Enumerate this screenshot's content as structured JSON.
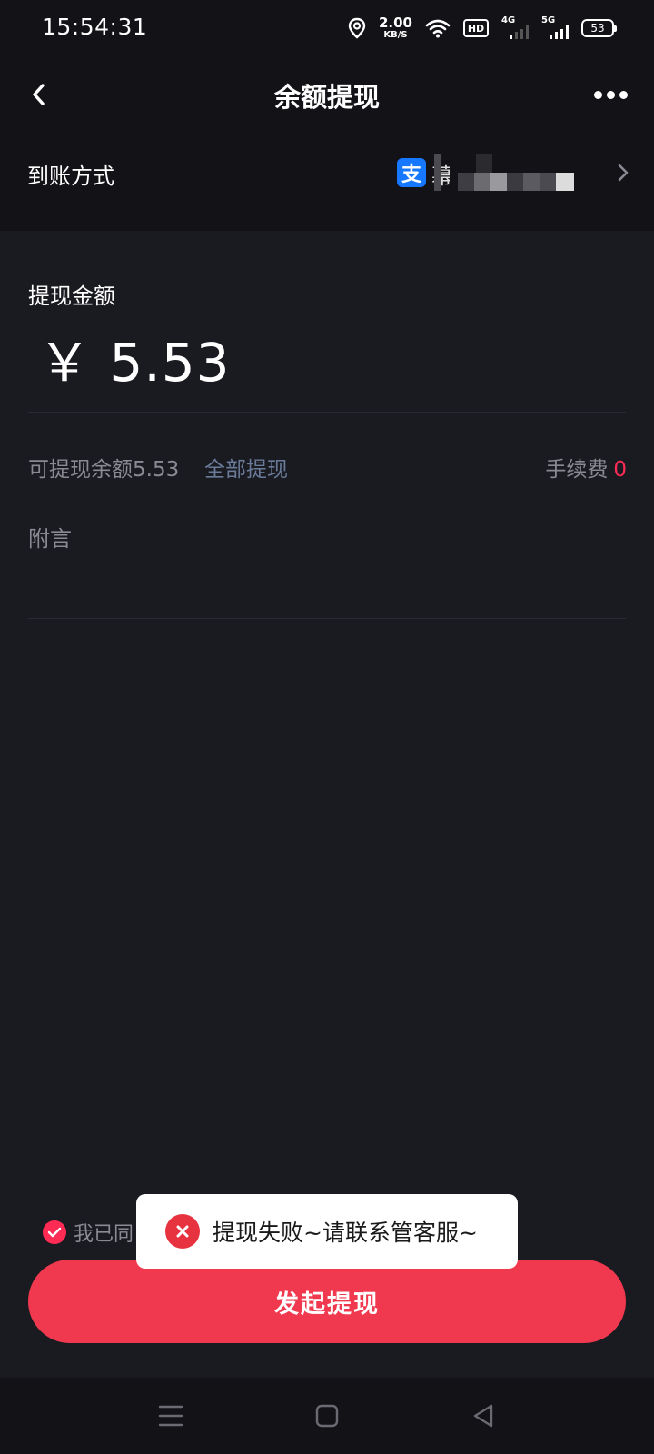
{
  "status_bar": {
    "time": "15:54:31",
    "speed_value": "2.00",
    "speed_unit": "KB/S",
    "hd_label": "HD",
    "network_4g": "4G",
    "network_5g": "5G",
    "battery": "53",
    "icons": [
      "location-icon",
      "wifi-icon",
      "signal-icon",
      "battery-icon"
    ]
  },
  "nav": {
    "title": "余额提现",
    "back_icon": "chevron-left-icon",
    "more_icon": "more-dots-icon"
  },
  "payment": {
    "label": "到账方式",
    "method_icon_glyph": "支",
    "account_name_partial": "幕",
    "brand_color": "#1677ff"
  },
  "amount": {
    "label": "提现金额",
    "value": "￥ 5.53"
  },
  "balance": {
    "available": "可提现余额5.53",
    "withdraw_all": "全部提现",
    "fee_label": "手续费",
    "fee_value": "0"
  },
  "remark": {
    "label": "附言"
  },
  "agreement": {
    "text": "我已同"
  },
  "toast": {
    "message": "提现失败~请联系管客服~",
    "status_color": "#e6333f"
  },
  "submit": {
    "label": "发起提现",
    "color": "#f0384e"
  },
  "system_nav": {
    "icons": [
      "menu-icon",
      "home-icon",
      "back-triangle-icon"
    ]
  }
}
